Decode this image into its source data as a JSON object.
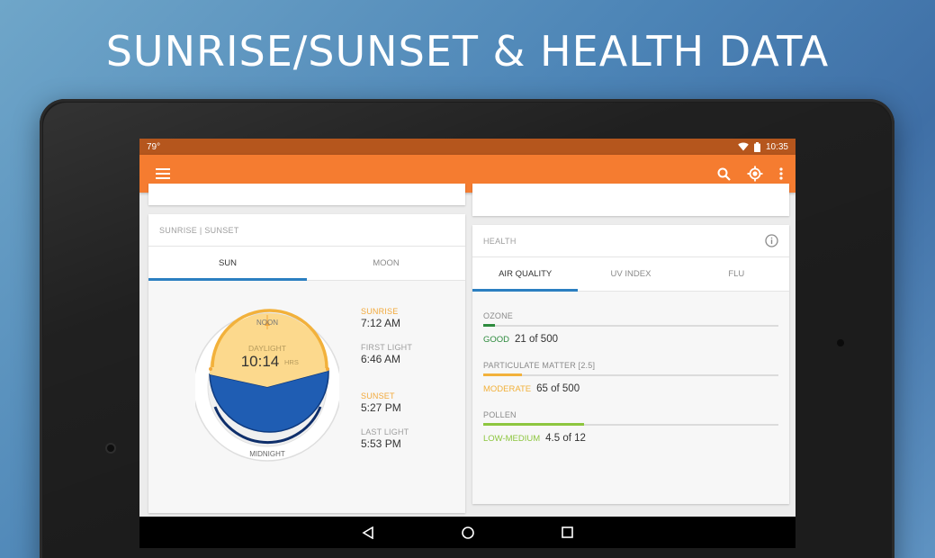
{
  "headline": "SUNRISE/SUNSET & HEALTH DATA",
  "status_bar": {
    "temperature": "79°",
    "time": "10:35"
  },
  "app_bar": {
    "menu_icon": "hamburger-menu-icon",
    "actions": [
      "search-icon",
      "my-location-icon",
      "more-vert-icon"
    ]
  },
  "sun_card": {
    "header": "SUNRISE | SUNSET",
    "tabs": [
      {
        "label": "SUN",
        "active": true
      },
      {
        "label": "MOON",
        "active": false
      }
    ],
    "dial": {
      "noon_label": "NOON",
      "midnight_label": "MIDNIGHT",
      "daylight_label": "DAYLIGHT",
      "daylight_value": "10:14",
      "daylight_unit": "HRS"
    },
    "times": {
      "sunrise_label": "SUNRISE",
      "sunrise_value": "7:12 AM",
      "first_light_label": "FIRST LIGHT",
      "first_light_value": "6:46 AM",
      "sunset_label": "SUNSET",
      "sunset_value": "5:27 PM",
      "last_light_label": "LAST LIGHT",
      "last_light_value": "5:53 PM"
    }
  },
  "health_card": {
    "header": "HEALTH",
    "info_icon": "info-icon",
    "tabs": [
      {
        "label": "AIR QUALITY",
        "active": true
      },
      {
        "label": "UV INDEX",
        "active": false
      },
      {
        "label": "FLU",
        "active": false
      }
    ],
    "metrics": [
      {
        "label": "OZONE",
        "status": "GOOD",
        "value": "21 of 500",
        "fraction": 0.04,
        "color": "#2e8b3e"
      },
      {
        "label": "PARTICULATE MATTER [2.5]",
        "status": "MODERATE",
        "value": "65 of 500",
        "fraction": 0.13,
        "color": "#f2b13b"
      },
      {
        "label": "POLLEN",
        "status": "LOW-MEDIUM",
        "value": "4.5 of 12",
        "fraction": 0.34,
        "color": "#8dc63f"
      }
    ]
  },
  "colors": {
    "status_bar": "#b5561d",
    "app_bar": "#f57c30",
    "tab_indicator": "#2b7fc1",
    "daylight": "#fcd98d",
    "night": "#1f5db3"
  },
  "nav_bar": {
    "buttons": [
      "back-icon",
      "home-icon",
      "recents-icon"
    ]
  }
}
